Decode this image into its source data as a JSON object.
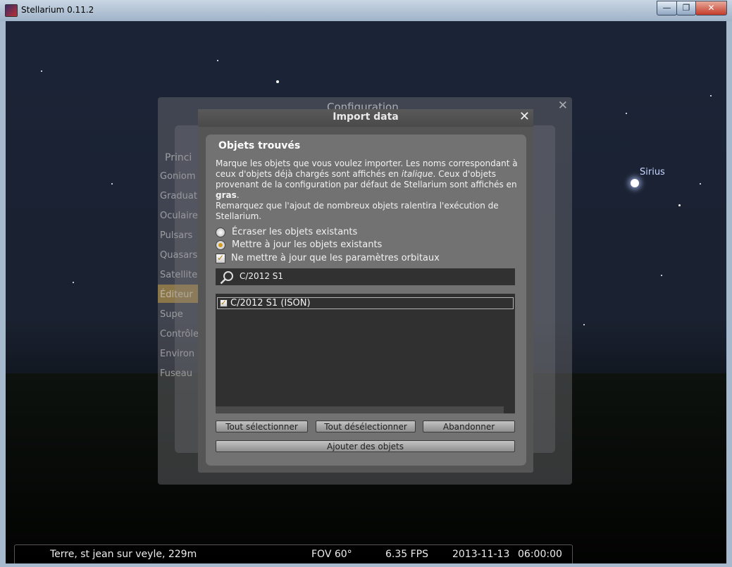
{
  "window": {
    "title": "Stellarium 0.11.2",
    "minimize": "—",
    "maximize": "❐",
    "close": "✕"
  },
  "sky": {
    "star_label": "Sirius"
  },
  "bg_dialog": {
    "title": "Configuration",
    "close": "✕",
    "sidebar": [
      "Princi",
      "Goniom",
      "Graduat",
      "Oculaire",
      "Pulsars",
      "Quasars",
      "Satellite",
      "Éditeur",
      "Supe",
      "Contrôle",
      "Environ",
      "Fuseau"
    ]
  },
  "import_dialog": {
    "title": "Import data",
    "close": "✕",
    "section_title": "Objets trouvés",
    "description": {
      "p1": "Marque les objets que vous voulez importer. Les noms correspondant à ceux d'objets déjà chargés sont affichés en ",
      "italic": "italique",
      "p2": ". Ceux d'objets provenant de la configuration par défaut de Stellarium sont affichés en ",
      "bold": "gras",
      "p3": ".",
      "p4": "Remarquez que l'ajout de nombreux objets ralentira l'exécution de Stellarium."
    },
    "options": {
      "overwrite_label": "Écraser les objets existants",
      "update_label": "Mettre à jour les objets existants",
      "orbital_only_label": "Ne mettre à jour que les paramètres orbitaux",
      "check_mark": "✓"
    },
    "search": {
      "value": "C/2012 S1"
    },
    "list_items": [
      {
        "label": "C/2012 S1 (ISON)",
        "checked": true
      }
    ],
    "buttons": {
      "select_all": "Tout sélectionner",
      "deselect_all": "Tout désélectionner",
      "cancel": "Abandonner",
      "add_objects": "Ajouter des objets"
    }
  },
  "statusbar": {
    "location": "Terre, st jean sur veyle, 229m",
    "fov": "FOV 60°",
    "fps": "6.35 FPS",
    "date": "2013-11-13",
    "time": "06:00:00"
  }
}
